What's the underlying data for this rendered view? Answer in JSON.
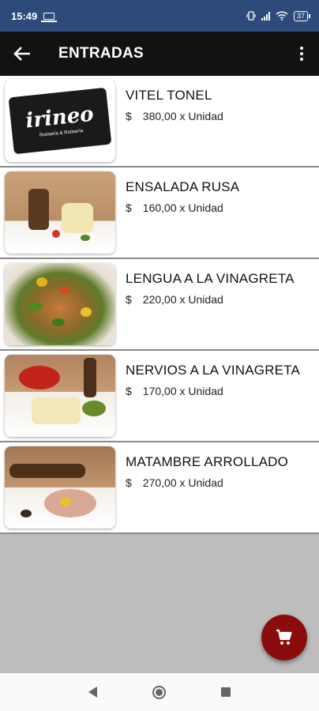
{
  "status_bar": {
    "time": "15:49",
    "battery": "37"
  },
  "app_bar": {
    "title": "ENTRADAS",
    "back_icon": "arrow-left-icon",
    "menu_icon": "more-vert-icon"
  },
  "products": [
    {
      "name": "VITEL TONEL",
      "currency": "$",
      "price": "380,00 x Unidad",
      "image": "irineo-logo",
      "logo": {
        "name": "irineo",
        "subtitle": "Rotisería & Rotisería"
      }
    },
    {
      "name": "ENSALADA RUSA",
      "currency": "$",
      "price": "160,00 x Unidad",
      "image": "ensalada-rusa-photo"
    },
    {
      "name": "LENGUA A LA VINAGRETA",
      "currency": "$",
      "price": "220,00 x Unidad",
      "image": "lengua-photo"
    },
    {
      "name": "NERVIOS A LA VINAGRETA",
      "currency": "$",
      "price": "170,00 x Unidad",
      "image": "nervios-photo"
    },
    {
      "name": "MATAMBRE ARROLLADO",
      "currency": "$",
      "price": "270,00 x Unidad",
      "image": "matambre-photo"
    }
  ],
  "fab": {
    "icon": "cart-icon",
    "color": "#8b0c0c"
  },
  "colors": {
    "status_bar": "#2e4a7a",
    "app_bar": "#121212",
    "accent": "#8b0c0c"
  }
}
